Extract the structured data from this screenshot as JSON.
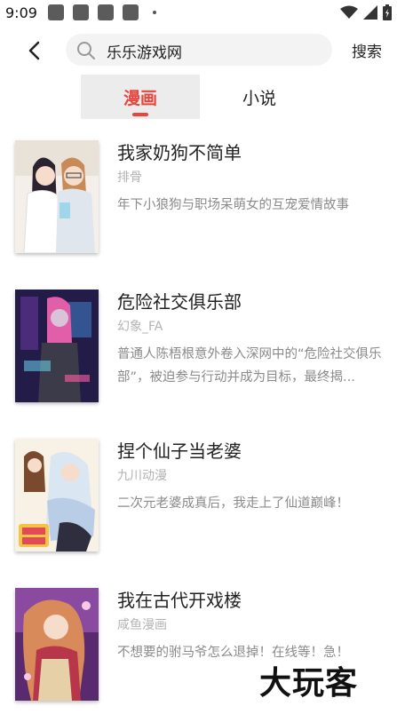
{
  "status_bar": {
    "time": "9:09",
    "icons": [
      "notification-icon",
      "notification-icon",
      "notification-icon",
      "notification-icon",
      "dot-icon",
      "wifi-icon",
      "signal-icon",
      "battery-icon"
    ]
  },
  "search": {
    "value": "乐乐游戏网",
    "button_label": "搜索"
  },
  "tabs": [
    {
      "label": "漫画",
      "active": true
    },
    {
      "label": "小说",
      "active": false
    }
  ],
  "results": [
    {
      "title": "我家奶狗不简单",
      "author": "排骨",
      "description": "年下小狼狗与职场呆萌女的互宠爱情故事"
    },
    {
      "title": "危险社交俱乐部",
      "author": "幻象_FA",
      "description": "普通人陈梧根意外卷入深网中的“危险社交俱乐部”，被迫参与行动并成为目标，最终揭..."
    },
    {
      "title": "捏个仙子当老婆",
      "author": "九川动漫",
      "description": "二次元老婆成真后，我走上了仙道巅峰！"
    },
    {
      "title": "我在古代开戏楼",
      "author": "咸鱼漫画",
      "description": "不想要的驸马爷怎么退掉！在线等！急！"
    }
  ],
  "watermark": "大玩客",
  "colors": {
    "accent": "#e8453c",
    "tab_bg": "#ececec",
    "search_bg": "#f3f3f3"
  }
}
